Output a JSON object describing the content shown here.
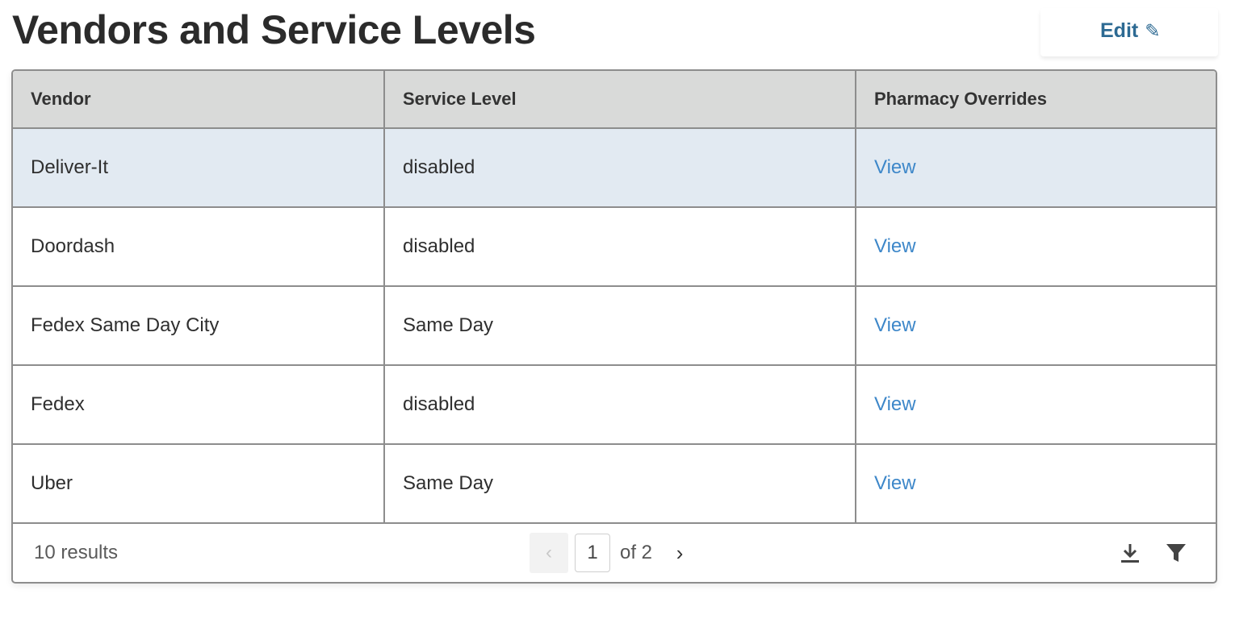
{
  "header": {
    "title": "Vendors and Service Levels",
    "edit_label": "Edit",
    "edit_icon": "✎"
  },
  "table": {
    "columns": [
      "Vendor",
      "Service Level",
      "Pharmacy Overrides"
    ],
    "rows": [
      {
        "vendor": "Deliver-It",
        "service_level": "disabled",
        "overrides": "View"
      },
      {
        "vendor": "Doordash",
        "service_level": "disabled",
        "overrides": "View"
      },
      {
        "vendor": "Fedex Same Day City",
        "service_level": "Same Day",
        "overrides": "View"
      },
      {
        "vendor": "Fedex",
        "service_level": "disabled",
        "overrides": "View"
      },
      {
        "vendor": "Uber",
        "service_level": "Same Day",
        "overrides": "View"
      }
    ]
  },
  "footer": {
    "result_count": "10 results",
    "current_page": "1",
    "of_pages": "of 2",
    "prev_icon": "‹",
    "next_icon": "›"
  },
  "icons": {
    "download": "download-icon",
    "filter": "filter-icon"
  },
  "colors": {
    "link": "#3d87c9",
    "edit": "#2d6a93",
    "header_bg": "#d9dad9",
    "highlight_row": "#e2eaf2"
  }
}
